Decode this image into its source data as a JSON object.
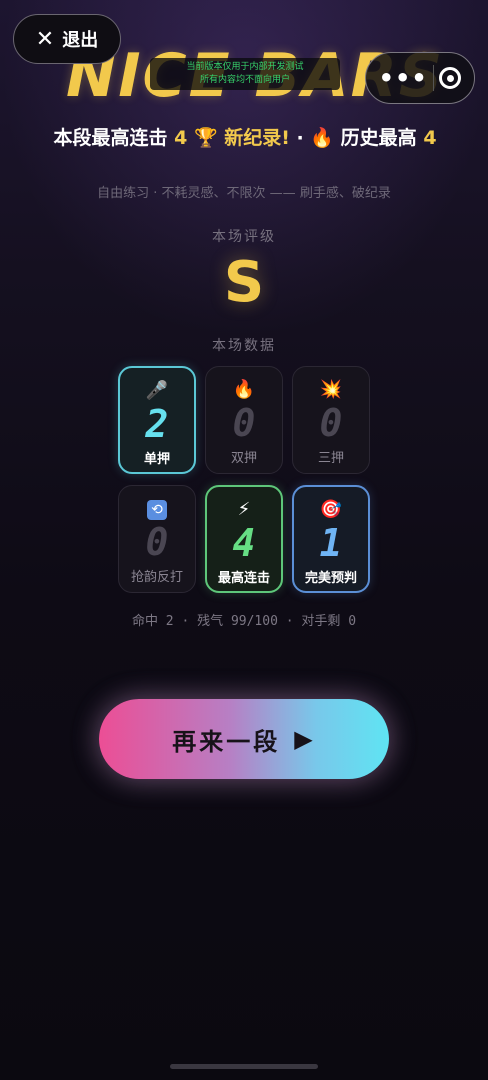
{
  "header": {
    "exit_label": "退出",
    "logo_text": "NICE BARS",
    "notice_line1": "当前版本仅用于内部开发测试",
    "notice_line2": "所有内容均不面向用户"
  },
  "record": {
    "prefix": "本段最高连击",
    "best_combo": "4",
    "trophy": "🏆",
    "new_record": "新纪录!",
    "separator": " · ",
    "fire": "🔥",
    "history_label": "历史最高",
    "history_best": "4"
  },
  "subtitle": "自由练习 · 不耗灵感、不限次 —— 刷手感、破纪录",
  "rating": {
    "label": "本场评级",
    "grade": "S"
  },
  "stats_section": {
    "label": "本场数据"
  },
  "cards": [
    {
      "icon": "🎤",
      "value": "2",
      "label": "单押"
    },
    {
      "icon": "🔥",
      "value": "0",
      "label": "双押"
    },
    {
      "icon": "💥",
      "value": "0",
      "label": "三押"
    },
    {
      "icon": "🔁",
      "value": "0",
      "label": "抢韵反打"
    },
    {
      "icon": "⚡",
      "value": "4",
      "label": "最高连击"
    },
    {
      "icon": "🎯",
      "value": "1",
      "label": "完美预判"
    }
  ],
  "summary": {
    "hits_label": "命中",
    "hits": "2",
    "hp_label": "残气",
    "hp": "99/100",
    "opponents_label": "对手剩",
    "opponents": "0"
  },
  "actions": {
    "again_label": "再来一段",
    "again_icon": "▶"
  },
  "colors": {
    "gold": "#f2c94c",
    "cyan": "#66e0ee",
    "green": "#66de84",
    "blue": "#6fb4f4"
  }
}
